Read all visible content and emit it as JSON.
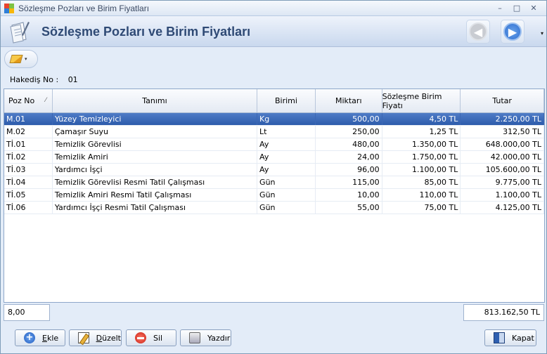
{
  "window": {
    "title": "Sözleşme Pozları ve Birim Fiyatları",
    "controls": [
      "–",
      "□",
      "✕"
    ]
  },
  "header": {
    "title": "Sözleşme Pozları ve Birim Fiyatları",
    "more_glyph": "▾"
  },
  "toolbar": {
    "menu_arrow": "▾"
  },
  "hakedis": {
    "label": "Hakediş No :",
    "value": "01"
  },
  "grid": {
    "columns": [
      "Poz No",
      "Tanımı",
      "Birimi",
      "Miktarı",
      "Sözleşme Birim Fiyatı",
      "Tutar"
    ],
    "sort_glyph": "⁄",
    "rows": [
      [
        "M.01",
        "Yüzey Temizleyici",
        "Kg",
        "500,00",
        "4,50 TL",
        "2.250,00 TL"
      ],
      [
        "M.02",
        "Çamaşır Suyu",
        "Lt",
        "250,00",
        "1,25 TL",
        "312,50 TL"
      ],
      [
        "Tİ.01",
        "Temizlik Görevlisi",
        "Ay",
        "480,00",
        "1.350,00 TL",
        "648.000,00 TL"
      ],
      [
        "Tİ.02",
        "Temizlik Amiri",
        "Ay",
        "24,00",
        "1.750,00 TL",
        "42.000,00 TL"
      ],
      [
        "Tİ.03",
        "Yardımcı İşçi",
        "Ay",
        "96,00",
        "1.100,00 TL",
        "105.600,00 TL"
      ],
      [
        "Tİ.04",
        "Temizlik Görevlisi Resmi Tatil Çalışması",
        "Gün",
        "115,00",
        "85,00 TL",
        "9.775,00 TL"
      ],
      [
        "Tİ.05",
        "Temizlik Amiri Resmi Tatil Çalışması",
        "Gün",
        "10,00",
        "110,00 TL",
        "1.100,00 TL"
      ],
      [
        "Tİ.06",
        "Yardımcı İşçi Resmi Tatil Çalışması",
        "Gün",
        "55,00",
        "75,00 TL",
        "4.125,00 TL"
      ]
    ],
    "selected_row": 0
  },
  "footer": {
    "count": "8,00",
    "total": "813.162,50 TL"
  },
  "buttons": {
    "add": {
      "first": "E",
      "rest": "kle"
    },
    "edit": {
      "first": "D",
      "rest": "üzelt"
    },
    "delete": "Sil",
    "print": "Yazdır",
    "close": "Kapat"
  },
  "icons": {
    "app": "app-icon",
    "header": "document-pencil-icon",
    "back": "back-arrow-icon",
    "forward": "forward-arrow-icon",
    "add": "plus-icon",
    "edit": "edit-icon",
    "delete": "minus-icon",
    "print": "printer-icon",
    "close": "exit-icon"
  },
  "colors": {
    "selection": "#2d5bab",
    "header_text": "#2f4a75",
    "nav_forward": "#2f6fd1"
  }
}
